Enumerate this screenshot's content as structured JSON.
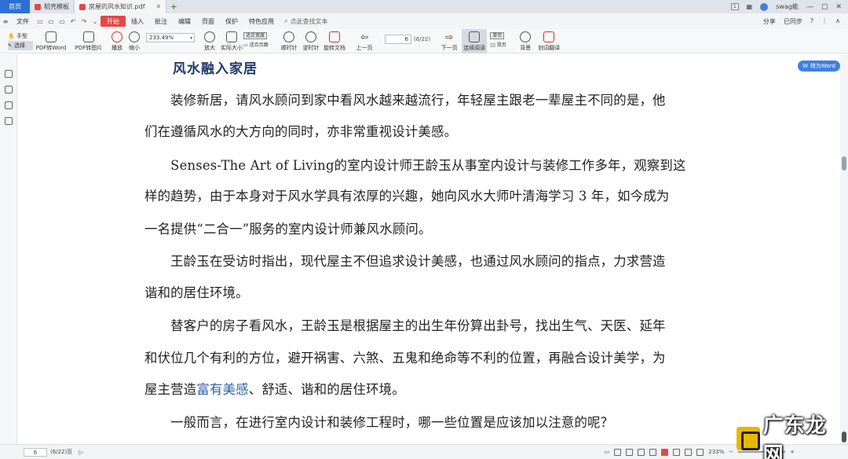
{
  "tabs": {
    "home": "首页",
    "items": [
      {
        "label": "稻壳模板",
        "color": "#e84545"
      },
      {
        "label": "房屋的风水知识.pdf",
        "color": "#e84545"
      }
    ],
    "add": "+"
  },
  "titlebar_right": {
    "page_badge": "1",
    "user": "swag能",
    "icons": [
      "grid-icon",
      "minimize-icon",
      "maximize-icon",
      "close-icon"
    ]
  },
  "menu": {
    "file": "文件",
    "items": [
      "开始",
      "插入",
      "批注",
      "编辑",
      "页面",
      "保护",
      "特色应用"
    ],
    "search": "点此查找文本",
    "right": [
      "分享",
      "已同步",
      "?",
      "⋮",
      "∧"
    ]
  },
  "toolbar": {
    "hand": "手型",
    "select": "选择",
    "pdf_to_word": "PDF转Word",
    "pdf_to_image": "PDF转图片",
    "play": "播放",
    "zoom_out": "缩小",
    "zoom_value": "233.49%",
    "zoom_in": "放大",
    "actual_size": "实际大小",
    "fit_width": "适合宽度",
    "fit_page": "适合页面",
    "rotate_left": "顺时针",
    "rotate_right": "逆时针",
    "rotate_doc": "旋转文档",
    "prev_page": "上一页",
    "page_value": "6",
    "page_count": "(6/22)",
    "next_page": "下一页",
    "continuous": "连续阅读",
    "single": "单页",
    "double": "双页",
    "background": "背景",
    "translate": "划词翻译"
  },
  "to_word": "转为Word",
  "document": {
    "heading": "风水融入家居",
    "lines": [
      "　　装修新居，请风水顾问到家中看风水越来越流行，年轻屋主跟老一辈屋主不同的是，他",
      "们在遵循风水的大方向的同时，亦非常重视设计美感。",
      "　　Senses-The Art of Living的室内设计师王龄玉从事室内设计与装修工作多年，观察到这",
      "样的趋势，由于本身对于风水学具有浓厚的兴趣，她向风水大师叶清海学习 3 年，如今成为",
      "一名提供“二合一”服务的室内设计师兼风水顾问。",
      "　　王龄玉在受访时指出，现代屋主不但追求设计美感，也通过风水顾问的指点，力求营造",
      "谐和的居住环境。",
      "　　替客户的房子看风水，王龄玉是根据屋主的出生年份算出卦号，找出生气、天医、延年",
      "和伏位几个有利的方位，避开祸害、六煞、五鬼和绝命等不利的位置，再融合设计美学，为"
    ],
    "line_last_pre": "屋主营造",
    "line_last_link": "富有美感",
    "line_last_post": "、舒适、谐和的居住环境。",
    "line_final": "　　一般而言，在进行室内设计和装修工程时，哪一些位置是应该加以注意的呢？"
  },
  "statusbar": {
    "page_value": "6",
    "page_count": "(6/22)页",
    "zoom": "233%"
  },
  "watermark": "广东龙网",
  "colors": {
    "accent": "#2e6fd6",
    "start": "#e84545",
    "heading": "#1f3a6b",
    "link": "#2c5fa8"
  }
}
